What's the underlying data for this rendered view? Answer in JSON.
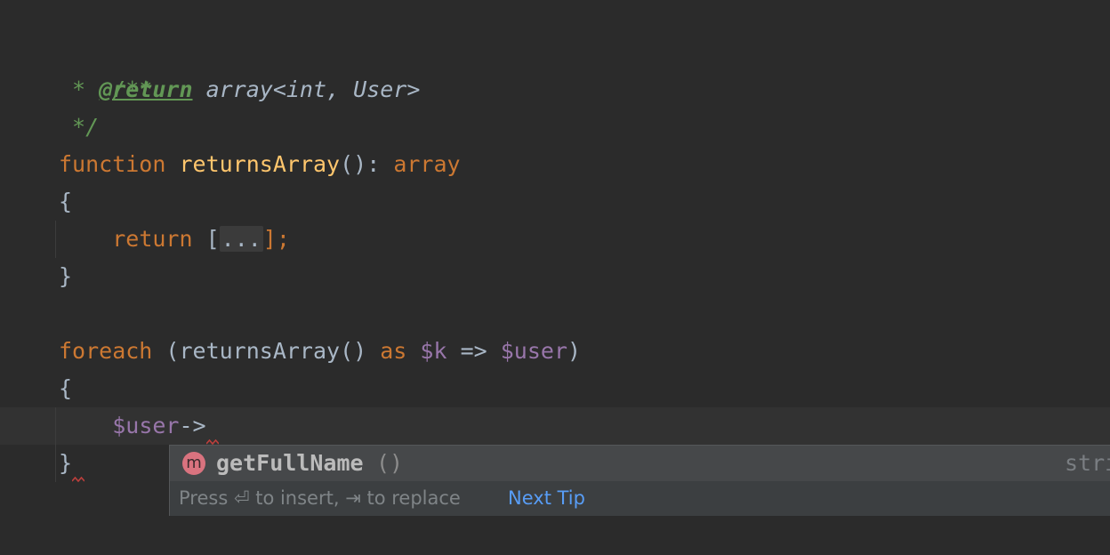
{
  "editor": {
    "lines": {
      "l1": {
        "doc_open": "/**"
      },
      "l2": {
        "doc_star": " * ",
        "doc_tag": "@return",
        "doc_type": " array<int, User>"
      },
      "l3": {
        "doc_close": " */"
      },
      "l4": {
        "kw_function": "function",
        "fn_name": "returnsArray",
        "punct": "(): ",
        "kw_array": "array"
      },
      "l5": {
        "brace": "{"
      },
      "l6": {
        "kw_return": "return",
        "open": " [",
        "folded": "...",
        "close": "];"
      },
      "l7": {
        "brace": "}"
      },
      "l9": {
        "kw_foreach": "foreach",
        "p1": " (returnsArray() ",
        "kw_as": "as",
        "sp": " ",
        "var_k": "$k",
        "arrow": " => ",
        "var_user": "$user",
        "p2": ")"
      },
      "l10": {
        "brace": "{"
      },
      "l11": {
        "var_user": "$user",
        "arrow": "->"
      },
      "l12": {
        "brace": "}"
      }
    }
  },
  "completion": {
    "icon_letter": "m",
    "method_name": "getFullName",
    "method_params": "()",
    "return_type": "stri",
    "footer_text": "Press ⏎ to insert, ⇥ to replace",
    "next_tip": "Next Tip"
  },
  "colors": {
    "background": "#2b2b2b",
    "doc_comment": "#629755",
    "keyword": "#cc7832",
    "function_name": "#ffc66d",
    "variable": "#9876aa",
    "method_icon": "#d9737f",
    "link": "#589df6"
  }
}
